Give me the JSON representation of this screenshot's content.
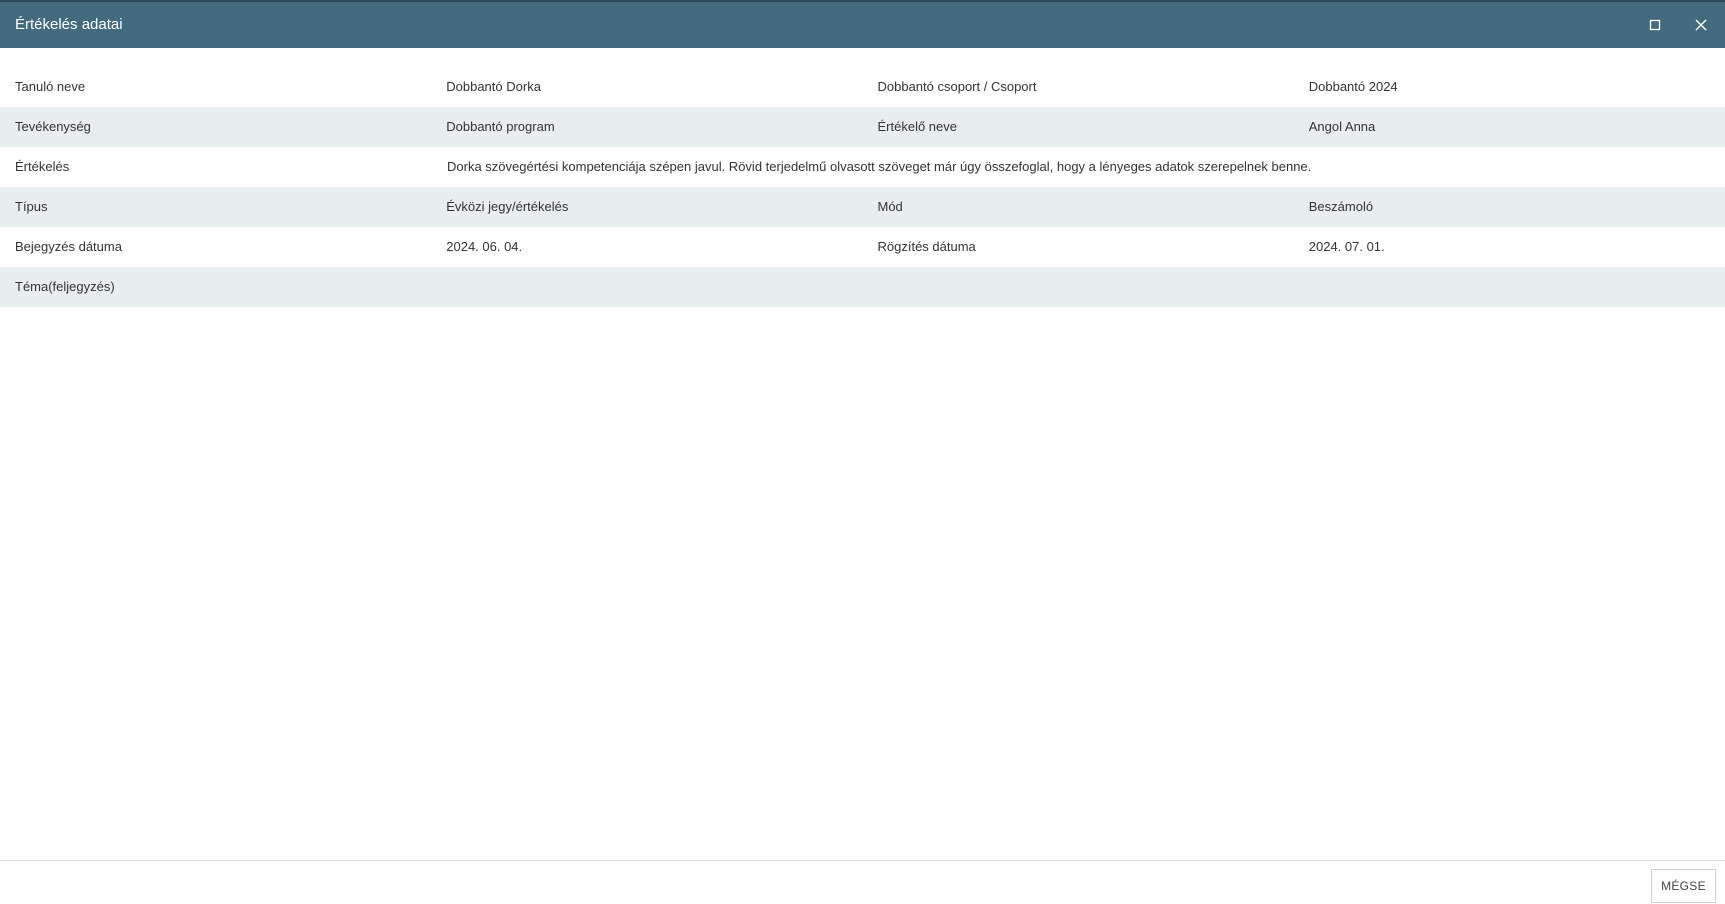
{
  "dialog": {
    "title": "Értékelés adatai",
    "maximize_icon": "maximize-icon",
    "close_icon": "close-icon",
    "header_color": "#436a7e"
  },
  "rows": [
    {
      "label1": "Tanuló neve",
      "value1": "Dobbantó Dorka",
      "label2": "Dobbantó csoport / Csoport",
      "value2": "Dobbantó 2024"
    },
    {
      "label1": "Tevékenység",
      "value1": "Dobbantó program",
      "label2": "Értékelő neve",
      "value2": "Angol Anna"
    },
    {
      "label1": "Értékelés",
      "value1": "Dorka szövegértési kompetenciája szépen javul. Rövid terjedelmű olvasott szöveget már úgy összefoglal, hogy a lényeges adatok szerepelnek benne."
    },
    {
      "label1": "Típus",
      "value1": "Évközi jegy/értékelés",
      "label2": "Mód",
      "value2": "Beszámoló"
    },
    {
      "label1": "Bejegyzés dátuma",
      "value1": "2024. 06. 04.",
      "label2": "Rögzítés dátuma",
      "value2": "2024. 07. 01."
    },
    {
      "label1": "Téma(feljegyzés)",
      "value1": ""
    }
  ],
  "footer": {
    "cancel_label": "MÉGSE"
  }
}
